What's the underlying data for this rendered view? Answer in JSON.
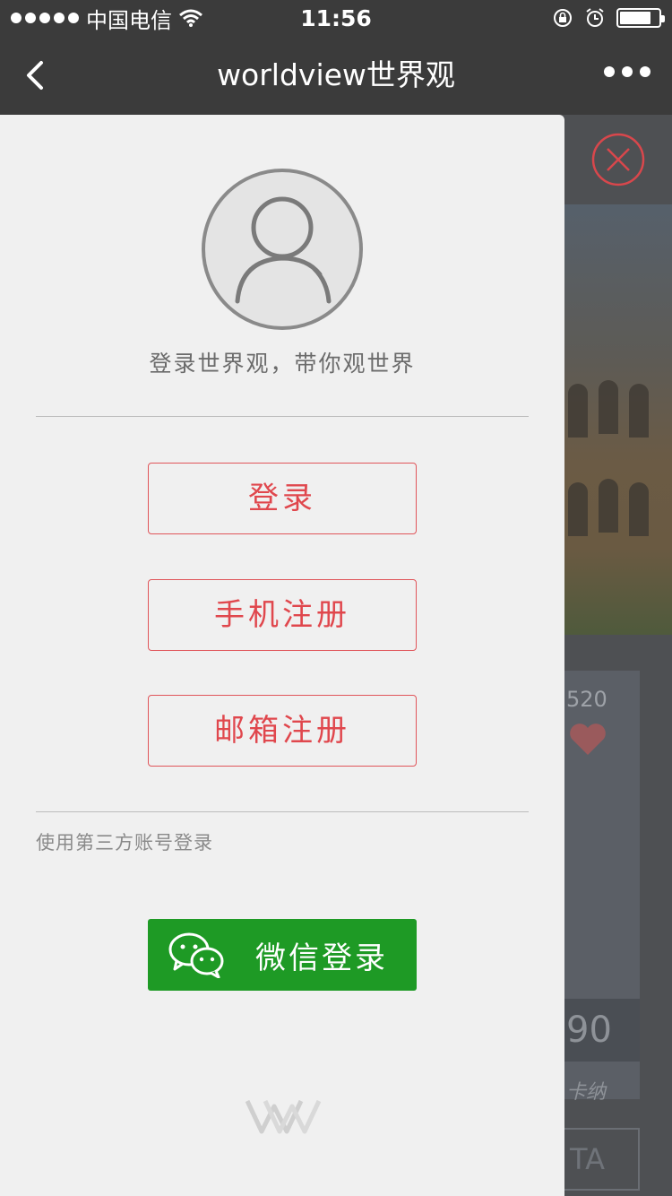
{
  "status_bar": {
    "carrier": "中国电信",
    "time": "11:56",
    "battery_level": 0.8
  },
  "nav": {
    "title": "worldview世界观",
    "back_icon": "chevron-left-icon",
    "more_icon": "more-dots-icon"
  },
  "drawer": {
    "avatar_icon": "user-avatar-icon",
    "tagline": "登录世界观，带你观世界",
    "login_label": "登录",
    "phone_register_label": "手机注册",
    "email_register_label": "邮箱注册",
    "third_party_label": "使用第三方账号登录",
    "wechat_login_label": "微信登录",
    "wechat_icon": "wechat-icon",
    "logo_icon": "worldview-logo-icon"
  },
  "background": {
    "close_icon": "close-circle-icon",
    "count": "520",
    "price": "90",
    "place": "卡纳",
    "button_fragment": "TA"
  },
  "colors": {
    "accent_red": "#e0474d",
    "wechat_green": "#1e9a25",
    "bar_dark": "#3b3b3b"
  }
}
